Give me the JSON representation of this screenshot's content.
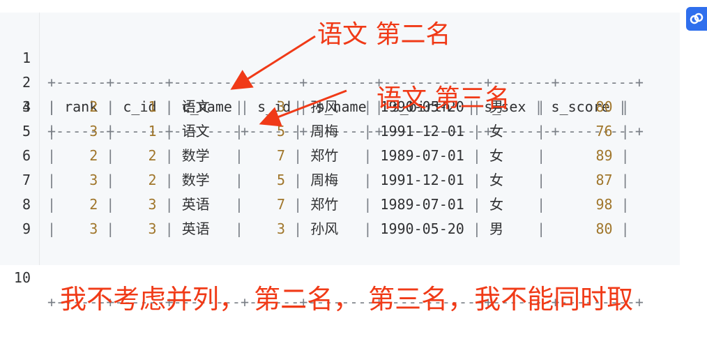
{
  "line_numbers": [
    "1",
    "2",
    "3",
    "4",
    "5",
    "6",
    "7",
    "8",
    "9",
    "10"
  ],
  "separator": "+------+------+--------+------+--------+------------+-------+---------+",
  "header": [
    "rank",
    "c_id",
    "c_name",
    "s_id",
    "s_name",
    "s_birth",
    "s_sex",
    "s_score"
  ],
  "rows": [
    [
      "2",
      "1",
      "语文",
      "3",
      "孙风",
      "1990-05-20",
      "男",
      "80"
    ],
    [
      "3",
      "1",
      "语文",
      "5",
      "周梅",
      "1991-12-01",
      "女",
      "76"
    ],
    [
      "2",
      "2",
      "数学",
      "7",
      "郑竹",
      "1989-07-01",
      "女",
      "89"
    ],
    [
      "3",
      "2",
      "数学",
      "5",
      "周梅",
      "1991-12-01",
      "女",
      "87"
    ],
    [
      "2",
      "3",
      "英语",
      "7",
      "郑竹",
      "1989-07-01",
      "女",
      "98"
    ],
    [
      "3",
      "3",
      "英语",
      "3",
      "孙风",
      "1990-05-20",
      "男",
      "80"
    ]
  ],
  "annotations": {
    "second_place": "语文 第二名",
    "third_place": "语文 第三名",
    "caption": "我不考虑并列， 第二名， 第三名，我不能同时取"
  },
  "colors": {
    "annotation": "#f03a17",
    "number": "#a0762b",
    "copy_button": "#2f6fed"
  },
  "icons": {
    "copy": "copy-icon"
  }
}
